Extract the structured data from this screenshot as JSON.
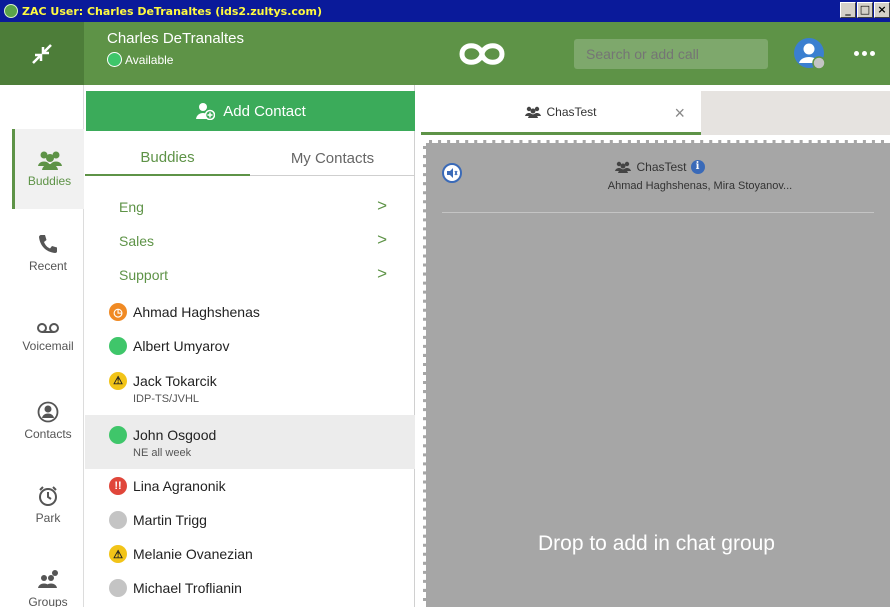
{
  "window": {
    "title": "ZAC User: Charles DeTranaltes (ids2.zultys.com)",
    "min_label": "_",
    "max_label": "□",
    "close_label": "×"
  },
  "header": {
    "user_name": "Charles DeTranaltes",
    "user_status": "Available",
    "search_placeholder": "Search or add call"
  },
  "nav": {
    "items": [
      {
        "label": "Buddies",
        "icon": "buddies-icon",
        "active": true
      },
      {
        "label": "Recent",
        "icon": "phone-icon"
      },
      {
        "label": "Voicemail",
        "icon": "voicemail-icon"
      },
      {
        "label": "Contacts",
        "icon": "contacts-icon"
      },
      {
        "label": "Park",
        "icon": "park-icon"
      },
      {
        "label": "Groups",
        "icon": "groups-icon"
      }
    ]
  },
  "panel": {
    "add_contact_label": "Add Contact",
    "tabs": [
      "Buddies",
      "My Contacts"
    ],
    "groups": [
      {
        "label": "Eng",
        "chevron": ">"
      },
      {
        "label": "Sales",
        "chevron": ">"
      },
      {
        "label": "Support",
        "chevron": ">"
      }
    ],
    "buddies": [
      {
        "name": "Ahmad Haghshenas",
        "status": "away",
        "color": "#f08a24",
        "glyph": "◷",
        "note": ""
      },
      {
        "name": "Albert Umyarov",
        "status": "available",
        "color": "#3fc66a",
        "glyph": "",
        "note": ""
      },
      {
        "name": "Jack Tokarcik",
        "status": "warning",
        "color": "#f2c418",
        "glyph": "⚠",
        "note": "IDP-TS/JVHL"
      },
      {
        "name": "John Osgood",
        "status": "available",
        "color": "#3fc66a",
        "glyph": "",
        "note": "NE all week"
      },
      {
        "name": "Lina Agranonik",
        "status": "busy",
        "color": "#e0463a",
        "glyph": "!!",
        "note": ""
      },
      {
        "name": "Martin Trigg",
        "status": "offline",
        "color": "#c4c4c4",
        "glyph": "",
        "note": ""
      },
      {
        "name": "Melanie Ovanezian",
        "status": "warning",
        "color": "#f2c418",
        "glyph": "⚠",
        "note": ""
      },
      {
        "name": "Michael Troflianin",
        "status": "offline",
        "color": "#c4c4c4",
        "glyph": "",
        "note": ""
      }
    ]
  },
  "chat": {
    "tab_label": "ChasTest",
    "tab_close": "×",
    "title": "ChasTest",
    "info_glyph": "i",
    "members": "Ahmad Haghshenas, Mira Stoyanov...",
    "drop_text": "Drop to add in chat group"
  },
  "colors": {
    "brand_green": "#5e9347",
    "add_button": "#3bab5a",
    "drop_zone": "#a6a6a6"
  }
}
